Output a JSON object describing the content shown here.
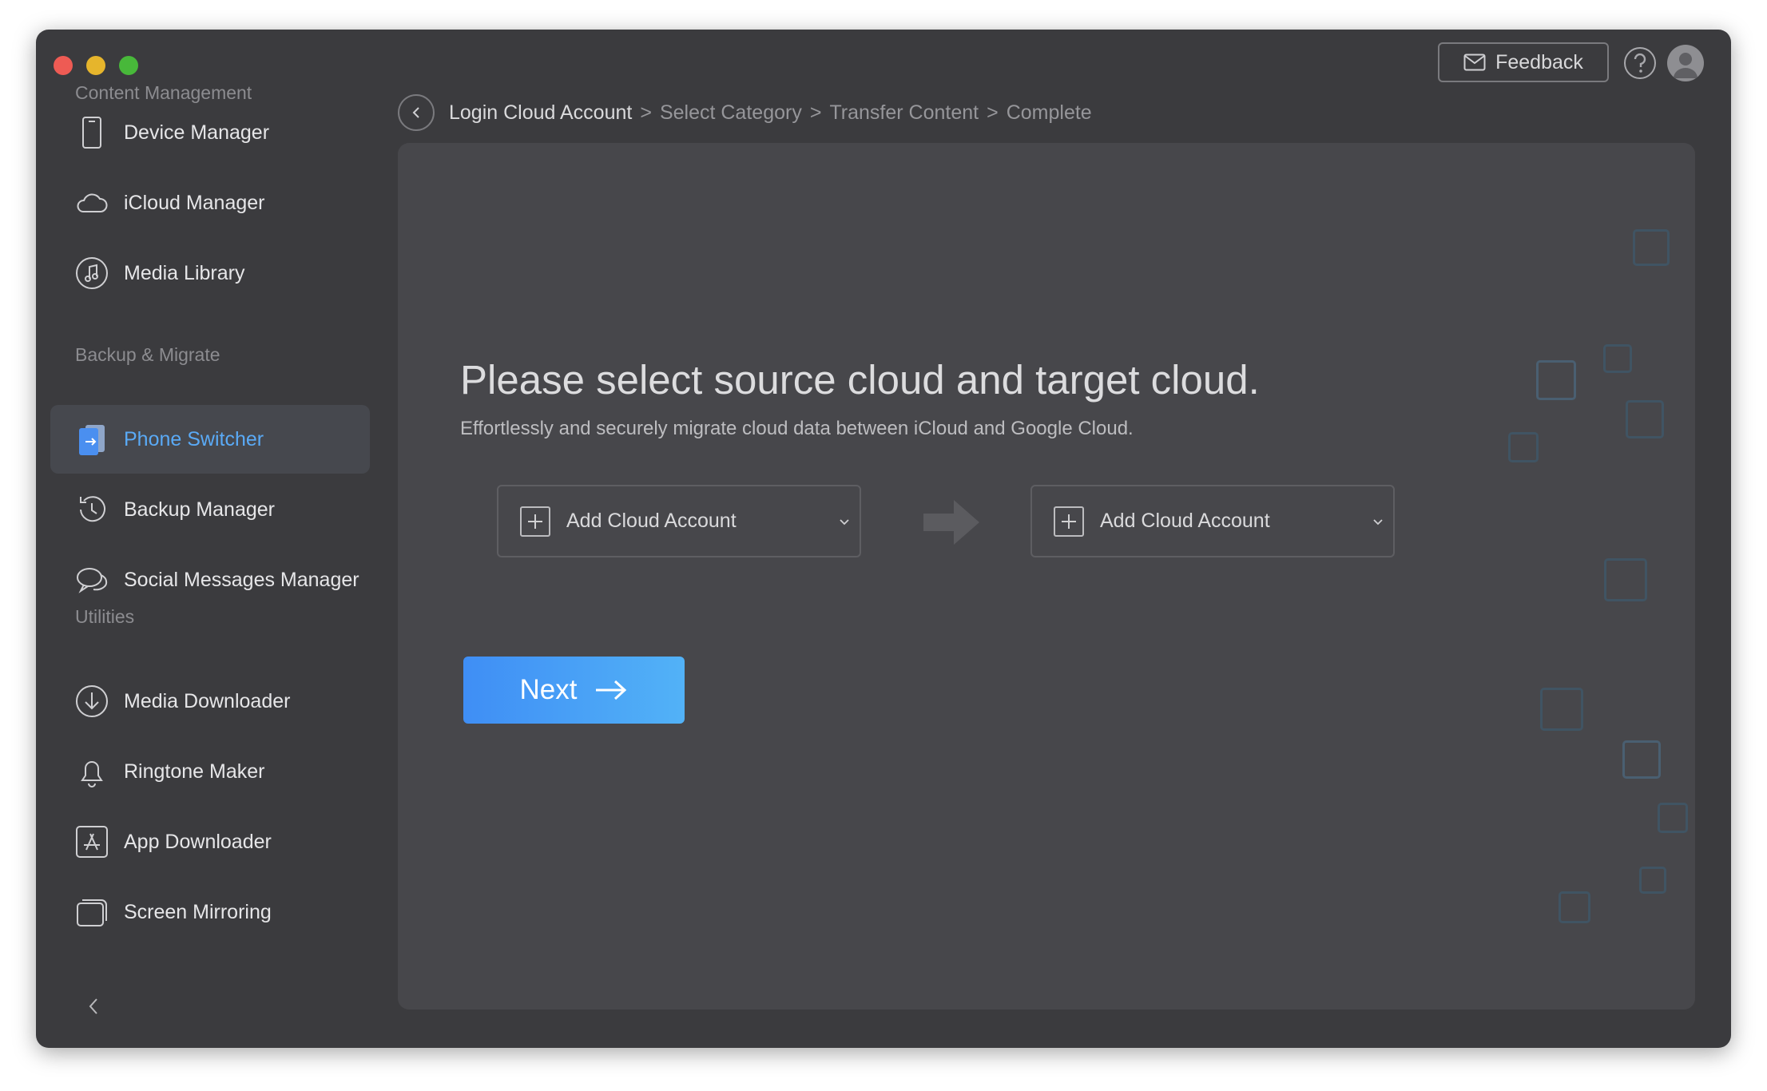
{
  "window": {
    "colors": {
      "background": "#3b3b3e",
      "content": "#47474b",
      "accent": "#4a9ef6"
    }
  },
  "sidebar": {
    "sections": [
      {
        "title": "Content Management"
      },
      {
        "title": "Backup & Migrate"
      },
      {
        "title": "Utilities"
      }
    ],
    "items": [
      {
        "label": "Device Manager",
        "icon": "phone-icon"
      },
      {
        "label": "iCloud Manager",
        "icon": "cloud-icon"
      },
      {
        "label": "Media Library",
        "icon": "music-icon"
      },
      {
        "label": "Phone Switcher",
        "icon": "phone-switch-icon",
        "active": true
      },
      {
        "label": "Backup Manager",
        "icon": "history-icon"
      },
      {
        "label": "Social Messages Manager",
        "icon": "chat-icon"
      },
      {
        "label": "Media Downloader",
        "icon": "download-icon"
      },
      {
        "label": "Ringtone Maker",
        "icon": "bell-icon"
      },
      {
        "label": "App Downloader",
        "icon": "app-store-icon"
      },
      {
        "label": "Screen Mirroring",
        "icon": "screen-mirror-icon"
      }
    ]
  },
  "topbar": {
    "feedback_label": "Feedback"
  },
  "breadcrumb": {
    "steps": [
      "Login Cloud Account",
      "Select Category",
      "Transfer Content",
      "Complete"
    ],
    "separator": ">"
  },
  "main": {
    "headline": "Please select source cloud and target cloud.",
    "subline": "Effortlessly and securely migrate cloud data between iCloud and Google Cloud.",
    "source_dropdown": {
      "label": "Add Cloud Account"
    },
    "target_dropdown": {
      "label": "Add Cloud Account"
    },
    "next_label": "Next"
  }
}
